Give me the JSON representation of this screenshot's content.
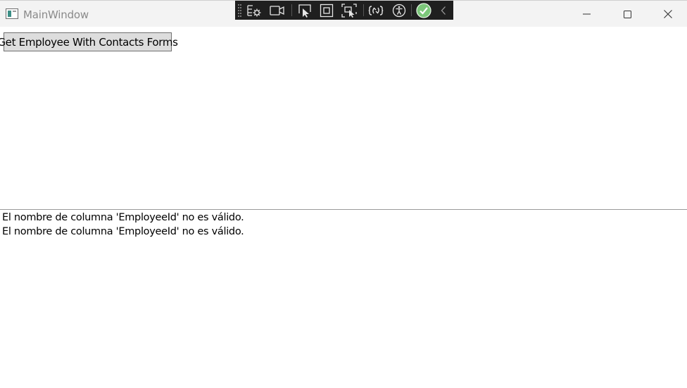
{
  "window": {
    "title": "MainWindow",
    "icon": "app-window-icon",
    "controls": [
      "minimize-icon",
      "maximize-icon",
      "close-icon"
    ]
  },
  "dev_toolbar": {
    "tools": [
      "live-visual-tree-icon",
      "track-focus-icon",
      "select-element-icon",
      "display-layout-adorners-icon",
      "track-focused-element-icon",
      "hot-reload-icon",
      "accessibility-icon",
      "status-ok-icon",
      "collapse-toolbar-icon"
    ]
  },
  "main": {
    "get_button_label": "Get Employee With Contacts Forms"
  },
  "log": {
    "lines": [
      "El nombre de columna 'EmployeeId' no es válido.",
      "El nombre de columna 'EmployeeId' no es válido."
    ]
  },
  "colors": {
    "titlebar_bg": "#f3f3f3",
    "devbar_bg": "#1f1f1f",
    "status_ok": "#7cc77a",
    "button_bg": "#dddddd"
  }
}
